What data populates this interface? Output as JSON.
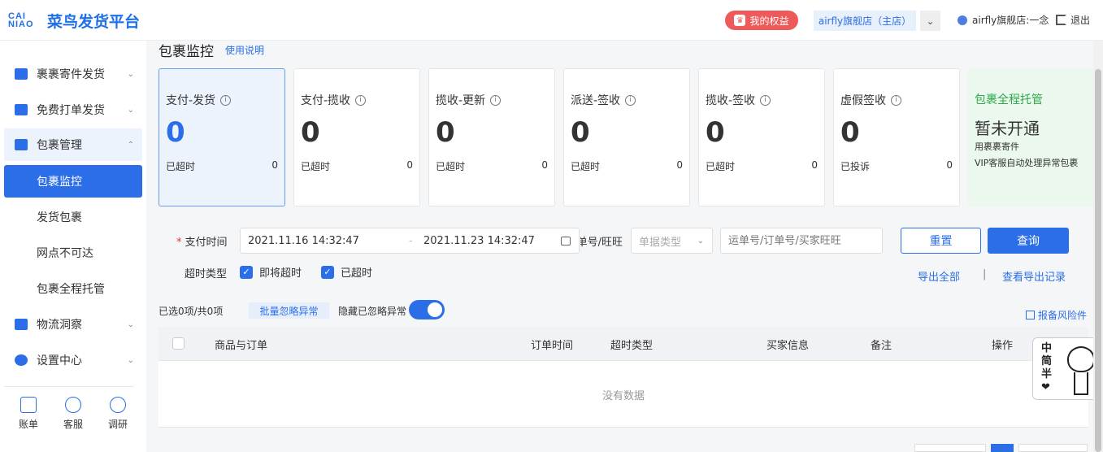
{
  "header": {
    "logo_mark": "CAI NIAO",
    "logo_text": "菜鸟发货平台",
    "rights_label": "我的权益",
    "shop_label": "airfly旗舰店（主店）",
    "user_label": "airfly旗舰店:一念",
    "logout_label": "退出"
  },
  "sidebar": {
    "items": [
      {
        "label": "裹裹寄件发货"
      },
      {
        "label": "免费打单发货"
      },
      {
        "label": "包裹管理"
      },
      {
        "label": "物流洞察"
      },
      {
        "label": "设置中心"
      }
    ],
    "sub_items": [
      {
        "label": "包裹监控"
      },
      {
        "label": "发货包裹"
      },
      {
        "label": "网点不可达"
      },
      {
        "label": "包裹全程托管"
      }
    ],
    "tools": [
      {
        "label": "账单"
      },
      {
        "label": "客服"
      },
      {
        "label": "调研"
      }
    ]
  },
  "main": {
    "title": "包裹监控",
    "help_link": "使用说明",
    "cards": [
      {
        "label": "支付-发货",
        "count": "0",
        "foot_label": "已超时",
        "foot_value": "0"
      },
      {
        "label": "支付-揽收",
        "count": "0",
        "foot_label": "已超时",
        "foot_value": "0"
      },
      {
        "label": "揽收-更新",
        "count": "0",
        "foot_label": "已超时",
        "foot_value": "0"
      },
      {
        "label": "派送-签收",
        "count": "0",
        "foot_label": "已超时",
        "foot_value": "0"
      },
      {
        "label": "揽收-签收",
        "count": "0",
        "foot_label": "已超时",
        "foot_value": "0"
      },
      {
        "label": "虚假签收",
        "count": "0",
        "foot_label": "已投诉",
        "foot_value": "0"
      }
    ],
    "promo": {
      "title": "包裹全程托管",
      "status": "暂未开通",
      "line1": "用裹裹寄件",
      "line2": "VIP客服自动处理异常包裹"
    }
  },
  "filters": {
    "pay_time_label": "支付时间",
    "date_start": "2021.11.16 14:32:47",
    "date_sep": "-",
    "date_end": "2021.11.23 14:32:47",
    "order_label": "单号/旺旺",
    "doc_type_placeholder": "单据类型",
    "search_placeholder": "运单号/订单号/买家旺旺",
    "reset_label": "重置",
    "query_label": "查询",
    "timeout_type_label": "超时类型",
    "chk_soon": "即将超时",
    "chk_over": "已超时",
    "export_all": "导出全部",
    "divider": "|",
    "export_records": "查看导出记录"
  },
  "list": {
    "selection": "已选0项/共0项",
    "batch_ignore": "批量忽略异常",
    "hide_ignored": "隐藏已忽略异常",
    "risk_link": "报备风险件",
    "columns": [
      "商品与订单",
      "订单时间",
      "超时类型",
      "买家信息",
      "备注",
      "操作"
    ],
    "empty_text": "没有数据"
  },
  "widget": {
    "text": "中简半❤"
  }
}
